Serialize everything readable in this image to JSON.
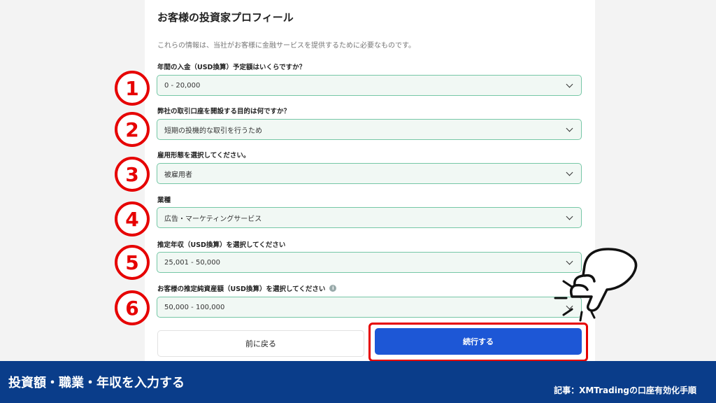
{
  "page": {
    "title": "お客様の投資家プロフィール",
    "subtitle": "これらの情報は、当社がお客様に金融サービスを提供するために必要なものです。"
  },
  "questions": [
    {
      "badge": "1",
      "label": "年間の入金（USD換算）予定額はいくらですか？",
      "value": "0 - 20,000"
    },
    {
      "badge": "2",
      "label": "弊社の取引口座を開設する目的は何ですか？",
      "value": "短期の投機的な取引を行うため"
    },
    {
      "badge": "3",
      "label": "雇用形態を選択してください。",
      "value": "被雇用者"
    },
    {
      "badge": "4",
      "label": "業種",
      "value": "広告・マーケティングサービス"
    },
    {
      "badge": "5",
      "label": "推定年収（USD換算）を選択してください",
      "value": "25,001 - 50,000"
    },
    {
      "badge": "6",
      "label": "お客様の推定純資産額（USD換算）を選択してください",
      "value": "50,000 - 100,000",
      "info_icon": "i"
    }
  ],
  "buttons": {
    "back": "前に戻る",
    "next": "続行する"
  },
  "footer": {
    "title": "投資額・職業・年収を入力する",
    "note": "記事：XMTradingの口座有効化手順"
  },
  "colors": {
    "accent_red": "#e60000",
    "primary_blue": "#1d57d6",
    "footer_blue": "#0a3d8a",
    "field_border": "#76c7a6",
    "field_bg": "#f1f8f4"
  }
}
